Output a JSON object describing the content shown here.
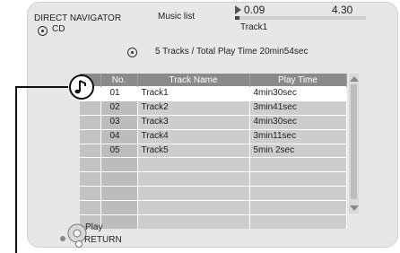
{
  "header": {
    "title": "DIRECT NAVIGATOR",
    "media": "CD",
    "list_name": "Music list",
    "elapsed": "0.09",
    "total_time": "4.30",
    "now_playing": "Track1",
    "progress_fraction": 0.033
  },
  "summary": "5 Tracks / Total Play Time 20min54sec",
  "table": {
    "columns": [
      "No.",
      "Track Name",
      "Play Time"
    ],
    "rows": [
      {
        "no": "01",
        "name": "Track1",
        "time": "4min30sec",
        "selected": true
      },
      {
        "no": "02",
        "name": "Track2",
        "time": "3min41sec"
      },
      {
        "no": "03",
        "name": "Track3",
        "time": "4min30sec"
      },
      {
        "no": "04",
        "name": "Track4",
        "time": "3min11sec"
      },
      {
        "no": "05",
        "name": "Track5",
        "time": "5min  2sec"
      },
      {
        "no": "",
        "name": "",
        "time": ""
      },
      {
        "no": "",
        "name": "",
        "time": ""
      },
      {
        "no": "",
        "name": "",
        "time": ""
      },
      {
        "no": "",
        "name": "",
        "time": ""
      },
      {
        "no": "",
        "name": "",
        "time": ""
      }
    ]
  },
  "footer": {
    "play_label": "Play",
    "return_label": "RETURN"
  },
  "icons": {
    "disc": "disc-icon",
    "play_status": "play-icon",
    "music_note": "music-note-icon",
    "remote_dpad": "dpad-icon"
  },
  "colors": {
    "header_bar": "#8a8a8a",
    "selected_row": "#ffffff",
    "row_fill": "#cdcdcd",
    "screen_bg": "#e7e7e7"
  }
}
